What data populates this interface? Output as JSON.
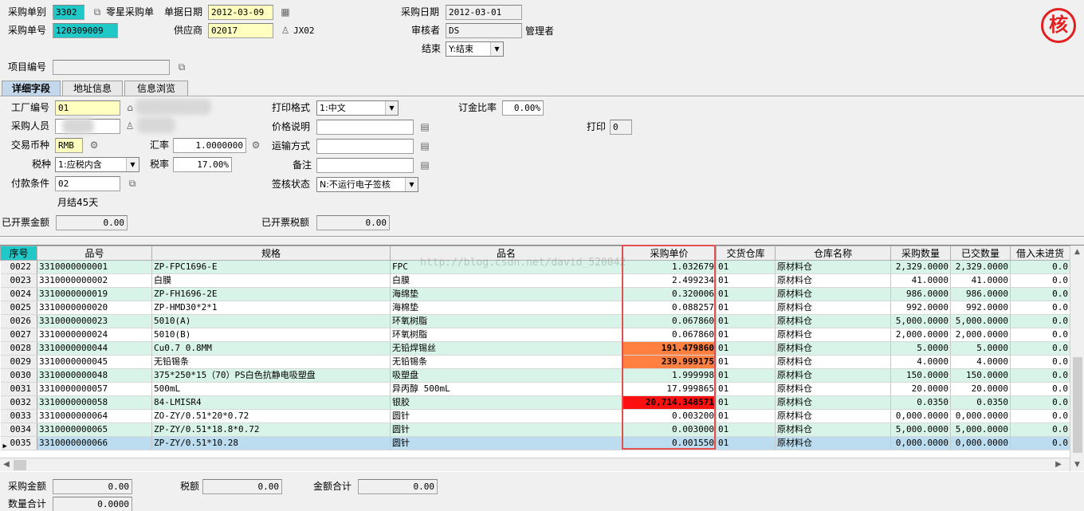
{
  "header": {
    "order_type_label": "采购单别",
    "order_type_value": "3302",
    "order_type_name": "零星采购单",
    "doc_date_label": "单据日期",
    "doc_date_value": "2012-03-09",
    "purchase_date_label": "采购日期",
    "purchase_date_value": "2012-03-01",
    "order_no_label": "采购单号",
    "order_no_value": "120309009",
    "supplier_label": "供应商",
    "supplier_value": "02017",
    "supplier_code": "JX02",
    "reviewer_label": "审核者",
    "reviewer_value": "DS",
    "reviewer_name": "管理者",
    "close_label": "结束",
    "close_value": "Y:结束",
    "project_label": "项目编号",
    "project_value": "",
    "seal_text": "核"
  },
  "tabs": [
    {
      "label": "详细字段",
      "active": true
    },
    {
      "label": "地址信息",
      "active": false
    },
    {
      "label": "信息浏览",
      "active": false
    }
  ],
  "detail": {
    "factory_label": "工厂编号",
    "factory_value": "01",
    "buyer_label": "采购人员",
    "buyer_value": "",
    "currency_label": "交易币种",
    "currency_value": "RMB",
    "rate_label": "汇率",
    "rate_value": "1.0000000",
    "tax_type_label": "税种",
    "tax_type_value": "1:应税内含",
    "tax_rate_label": "税率",
    "tax_rate_value": "17.00%",
    "payment_label": "付款条件",
    "payment_value": "02",
    "payment_desc": "月结45天",
    "invoiced_amount_label": "已开票金额",
    "invoiced_amount_value": "0.00",
    "print_format_label": "打印格式",
    "print_format_value": "1:中文",
    "price_note_label": "价格说明",
    "price_note_value": "",
    "shipping_label": "运输方式",
    "shipping_value": "",
    "remark_label": "备注",
    "remark_value": "",
    "sign_status_label": "签核状态",
    "sign_status_value": "N:不运行电子签核",
    "invoiced_tax_label": "已开票税额",
    "invoiced_tax_value": "0.00",
    "deposit_ratio_label": "订金比率",
    "deposit_ratio_value": "0.00%",
    "print_label": "打印",
    "print_value": "0"
  },
  "grid": {
    "columns": [
      "序号",
      "品号",
      "规格",
      "品名",
      "采购单价",
      "交货仓库",
      "仓库名称",
      "采购数量",
      "已交数量",
      "借入未进货"
    ],
    "rows": [
      {
        "seq": "0022",
        "item": "3310000000001",
        "spec": "ZP-FPC1696-E",
        "name": "FPC",
        "price": "1.032679",
        "wh": "01",
        "whname": "原材料仓",
        "qty": "2,329.0000",
        "delivered": "2,329.0000",
        "borrow": "0.0"
      },
      {
        "seq": "0023",
        "item": "3310000000002",
        "spec": "白膜",
        "name": "白膜",
        "price": "2.499234",
        "wh": "01",
        "whname": "原材料仓",
        "qty": "41.0000",
        "delivered": "41.0000",
        "borrow": "0.0"
      },
      {
        "seq": "0024",
        "item": "3310000000019",
        "spec": "ZP-FH1696-2E",
        "name": "海绵垫",
        "price": "0.320006",
        "wh": "01",
        "whname": "原材料仓",
        "qty": "986.0000",
        "delivered": "986.0000",
        "borrow": "0.0"
      },
      {
        "seq": "0025",
        "item": "3310000000020",
        "spec": "ZP-HMD30*2*1",
        "name": "海棉垫",
        "price": "0.088257",
        "wh": "01",
        "whname": "原材料仓",
        "qty": "992.0000",
        "delivered": "992.0000",
        "borrow": "0.0"
      },
      {
        "seq": "0026",
        "item": "3310000000023",
        "spec": "5010(A)",
        "name": "环氧树脂",
        "price": "0.067860",
        "wh": "01",
        "whname": "原材料仓",
        "qty": "5,000.0000",
        "delivered": "5,000.0000",
        "borrow": "0.0"
      },
      {
        "seq": "0027",
        "item": "3310000000024",
        "spec": "5010(B)",
        "name": "环氧树脂",
        "price": "0.067860",
        "wh": "01",
        "whname": "原材料仓",
        "qty": "2,000.0000",
        "delivered": "2,000.0000",
        "borrow": "0.0"
      },
      {
        "seq": "0028",
        "item": "3310000000044",
        "spec": "Cu0.7 0.8MM",
        "name": "无铅焊锡丝",
        "price": "191.479860",
        "wh": "01",
        "whname": "原材料仓",
        "qty": "5.0000",
        "delivered": "5.0000",
        "borrow": "0.0",
        "hl": "orange"
      },
      {
        "seq": "0029",
        "item": "3310000000045",
        "spec": "无铅锡条",
        "name": "无铅锡条",
        "price": "239.999175",
        "wh": "01",
        "whname": "原材料仓",
        "qty": "4.0000",
        "delivered": "4.0000",
        "borrow": "0.0",
        "hl": "orange"
      },
      {
        "seq": "0030",
        "item": "3310000000048",
        "spec": "375*250*15（70）PS白色抗静电吸塑盘",
        "name": "吸塑盘",
        "price": "1.999998",
        "wh": "01",
        "whname": "原材料仓",
        "qty": "150.0000",
        "delivered": "150.0000",
        "borrow": "0.0"
      },
      {
        "seq": "0031",
        "item": "3310000000057",
        "spec": "500mL",
        "name": "异丙醇  500mL",
        "price": "17.999865",
        "wh": "01",
        "whname": "原材料仓",
        "qty": "20.0000",
        "delivered": "20.0000",
        "borrow": "0.0"
      },
      {
        "seq": "0032",
        "item": "3310000000058",
        "spec": "84-LMISR4",
        "name": "银胶",
        "price": "20,714.348571",
        "wh": "01",
        "whname": "原材料仓",
        "qty": "0.0350",
        "delivered": "0.0350",
        "borrow": "0.0",
        "hl": "red"
      },
      {
        "seq": "0033",
        "item": "3310000000064",
        "spec": "ZO-ZY/0.51*20*0.72",
        "name": "圆针",
        "price": "0.003200",
        "wh": "01",
        "whname": "原材料仓",
        "qty": "0,000.0000",
        "delivered": "0,000.0000",
        "borrow": "0.0"
      },
      {
        "seq": "0034",
        "item": "3310000000065",
        "spec": "ZP-ZY/0.51*18.8*0.72",
        "name": "圆针",
        "price": "0.003000",
        "wh": "01",
        "whname": "原材料仓",
        "qty": "5,000.0000",
        "delivered": "5,000.0000",
        "borrow": "0.0"
      },
      {
        "seq": "0035",
        "item": "3310000000066",
        "spec": "ZP-ZY/0.51*10.28",
        "name": "圆针",
        "price": "0.001550",
        "wh": "01",
        "whname": "原材料仓",
        "qty": "0,000.0000",
        "delivered": "0,000.0000",
        "borrow": "0.0",
        "selected": true
      }
    ],
    "watermark": "http://blog.csdn.net/david_520042"
  },
  "footer": {
    "amount_label": "采购金额",
    "amount_value": "0.00",
    "tax_label": "税额",
    "tax_value": "0.00",
    "total_label": "金额合计",
    "total_value": "0.00",
    "qty_total_label": "数量合计",
    "qty_total_value": "0.0000"
  },
  "colors": {
    "cyan_field": "#20c8c8",
    "yellow_field": "#ffffc0",
    "row_odd": "#d8f4e8",
    "row_selected": "#bcdcf0",
    "highlight_orange": "#ff8040",
    "highlight_red": "#ff1010",
    "seal": "#e02020"
  }
}
